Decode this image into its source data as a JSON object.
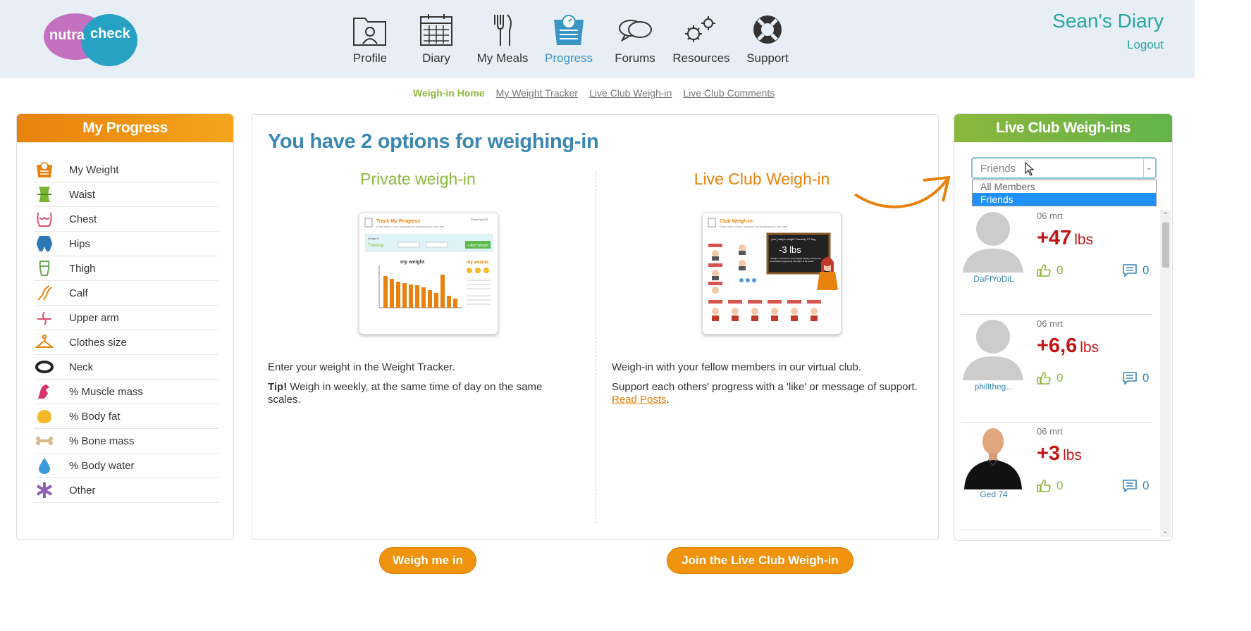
{
  "logo": {
    "part1": "nutra",
    "part2": "check"
  },
  "nav": [
    {
      "label": "Profile",
      "icon": "profile-icon"
    },
    {
      "label": "Diary",
      "icon": "diary-icon"
    },
    {
      "label": "My Meals",
      "icon": "meals-icon"
    },
    {
      "label": "Progress",
      "icon": "scales-icon",
      "active": true
    },
    {
      "label": "Forums",
      "icon": "forums-icon"
    },
    {
      "label": "Resources",
      "icon": "resources-icon"
    },
    {
      "label": "Support",
      "icon": "lifebuoy-icon"
    }
  ],
  "user": {
    "diary_title": "Sean's Diary",
    "logout": "Logout"
  },
  "subnav": [
    "Weigh-in Home",
    "My Weight Tracker",
    "Live Club Weigh-in",
    "Live Club Comments"
  ],
  "left_panel": {
    "title": "My Progress",
    "items": [
      {
        "label": "My Weight",
        "icon": "scales-icon"
      },
      {
        "label": "Waist",
        "icon": "waist-icon"
      },
      {
        "label": "Chest",
        "icon": "chest-icon"
      },
      {
        "label": "Hips",
        "icon": "hips-icon"
      },
      {
        "label": "Thigh",
        "icon": "thigh-icon"
      },
      {
        "label": "Calf",
        "icon": "calf-icon"
      },
      {
        "label": "Upper arm",
        "icon": "upper-arm-icon"
      },
      {
        "label": "Clothes size",
        "icon": "hanger-icon"
      },
      {
        "label": "Neck",
        "icon": "neck-icon"
      },
      {
        "label": "% Muscle mass",
        "icon": "muscle-icon"
      },
      {
        "label": "% Body fat",
        "icon": "fat-icon"
      },
      {
        "label": "% Bone mass",
        "icon": "bone-icon"
      },
      {
        "label": "% Body water",
        "icon": "water-drop-icon"
      },
      {
        "label": "Other",
        "icon": "asterisk-icon"
      }
    ]
  },
  "main": {
    "title": "You have 2 options for weighing-in",
    "private": {
      "heading": "Private weigh-in",
      "thumb_title": "Track My Progress",
      "thumb_sub": "Keep track of your progress by updating your info here",
      "thumb_show": "Show Bar/Off",
      "thumb_weigh_in": "Weigh-in",
      "thumb_day": "Tuesday",
      "thumb_add": "+ Add Weight",
      "thumb_chart_title": "my weight",
      "thumb_awards": "my awards",
      "text1": "Enter your weight in the Weight Tracker.",
      "tip_label": "Tip!",
      "tip_text": " Weigh in weekly, at the same time of day on the same scales.",
      "button": "Weigh me in"
    },
    "club": {
      "heading": "Live Club Weigh-in",
      "thumb_title": "Club Weigh-in",
      "thumb_sub": "Keep track of your progress by updating your info here",
      "thumb_board_head": "your_sally's weight  Tuesday 17 Aug",
      "thumb_board_value": "-3 lbs",
      "thumb_board_note": "Thought I continued. Loved slightly slightly, feeling very comfortable progressing with team at all goals!!",
      "text1": "Weigh-in with your fellow members in our virtual club.",
      "text2": "Support each others' progress with a 'like' or message of support.",
      "read_posts": "Read Posts",
      "text2_end": ".",
      "button": "Join the Live Club Weigh-in"
    }
  },
  "right_panel": {
    "title": "Live Club Weigh-ins",
    "select_value": "Friends",
    "options": [
      "All Members",
      "Friends"
    ],
    "selected_option": "Friends",
    "entries": [
      {
        "date": "06 mrt",
        "value": "+47",
        "unit": "lbs",
        "likes": "0",
        "comments": "0",
        "user": "DaFfYoDiL",
        "avatar": "placeholder-avatar"
      },
      {
        "date": "06 mrt",
        "value": "+6,6",
        "unit": "lbs",
        "likes": "0",
        "comments": "0",
        "user": "philltheg...",
        "avatar": "placeholder-avatar"
      },
      {
        "date": "06 mrt",
        "value": "+3",
        "unit": "lbs",
        "likes": "0",
        "comments": "0",
        "user": "Ged 74",
        "avatar": "photo-avatar"
      }
    ]
  },
  "colors": {
    "header_bg": "#e7eef6",
    "teal": "#2aa6a0",
    "orange": "#f0930f",
    "green": "#8db83a",
    "blue": "#3b87b3",
    "red": "#c41515"
  }
}
